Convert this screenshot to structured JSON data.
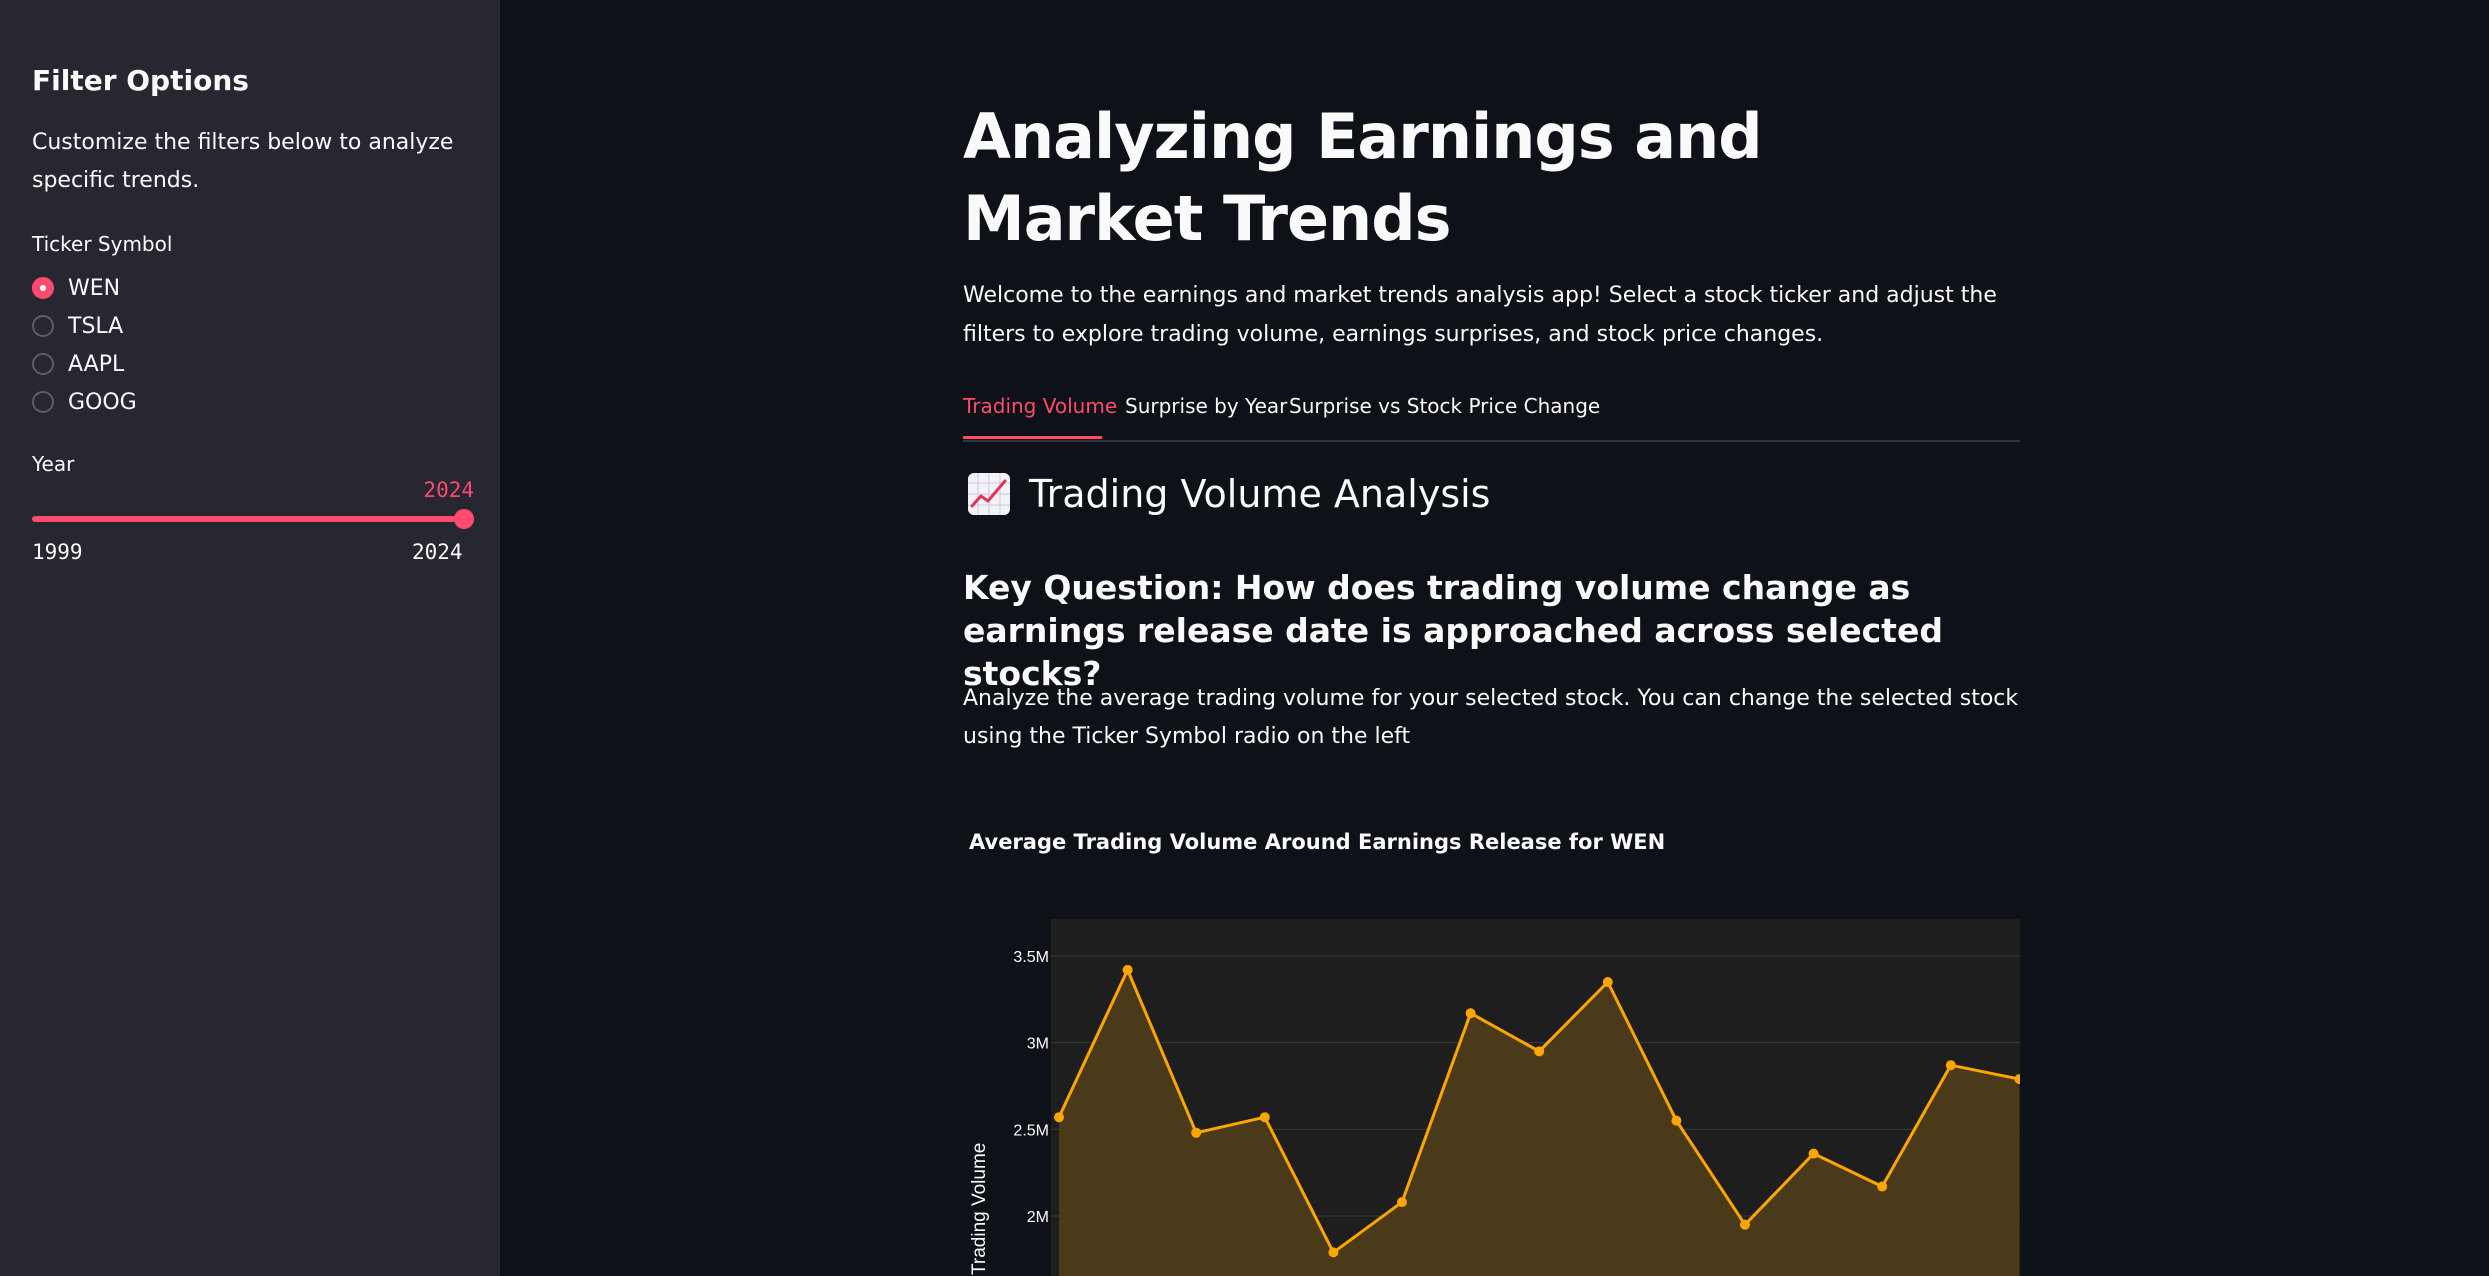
{
  "sidebar": {
    "title": "Filter Options",
    "description": "Customize the filters below to analyze specific trends.",
    "ticker_label": "Ticker Symbol",
    "tickers": [
      "WEN",
      "TSLA",
      "AAPL",
      "GOOG"
    ],
    "selected_ticker": "WEN",
    "year_label": "Year",
    "year_value": "2024",
    "year_min": "1999",
    "year_max": "2024"
  },
  "main": {
    "title": "Analyzing Earnings and Market Trends",
    "intro": "Welcome to the earnings and market trends analysis app! Select a stock ticker and adjust the filters to explore trading volume, earnings surprises, and stock price changes.",
    "tabs": [
      {
        "label": "Trading Volume",
        "active": true
      },
      {
        "label": "Surprise by Year",
        "active": false
      },
      {
        "label": "Surprise vs Stock Price Change",
        "active": false
      }
    ],
    "section_heading": "Trading Volume Analysis",
    "section_icon": "chart-increasing-icon",
    "question": "Key Question: How does trading volume change as earnings release date is approached across selected stocks?",
    "paragraph": "Analyze the average trading volume for your selected stock. You can change the selected stock using the Ticker Symbol radio on the left"
  },
  "colors": {
    "accent": "#ff4b6e",
    "background": "#0e1117",
    "sidebar_bg": "#262730",
    "line": "#ffa500",
    "area": "#4b3a1a",
    "plot_bg": "#1e1e1e"
  },
  "chart_data": {
    "type": "area",
    "title": "Average Trading Volume Around Earnings Release for WEN",
    "ylabel": "Trading Volume",
    "yticks": [
      "3.5M",
      "3M",
      "2.5M",
      "2M"
    ],
    "ytick_values": [
      3500000,
      3000000,
      2500000,
      2000000
    ],
    "ylim_visible": [
      1600000,
      3700000
    ],
    "values": [
      2570000,
      3420000,
      2480000,
      2570000,
      1790000,
      2080000,
      3170000,
      2950000,
      3350000,
      2550000,
      1950000,
      2360000,
      2170000,
      2870000,
      2790000
    ]
  }
}
